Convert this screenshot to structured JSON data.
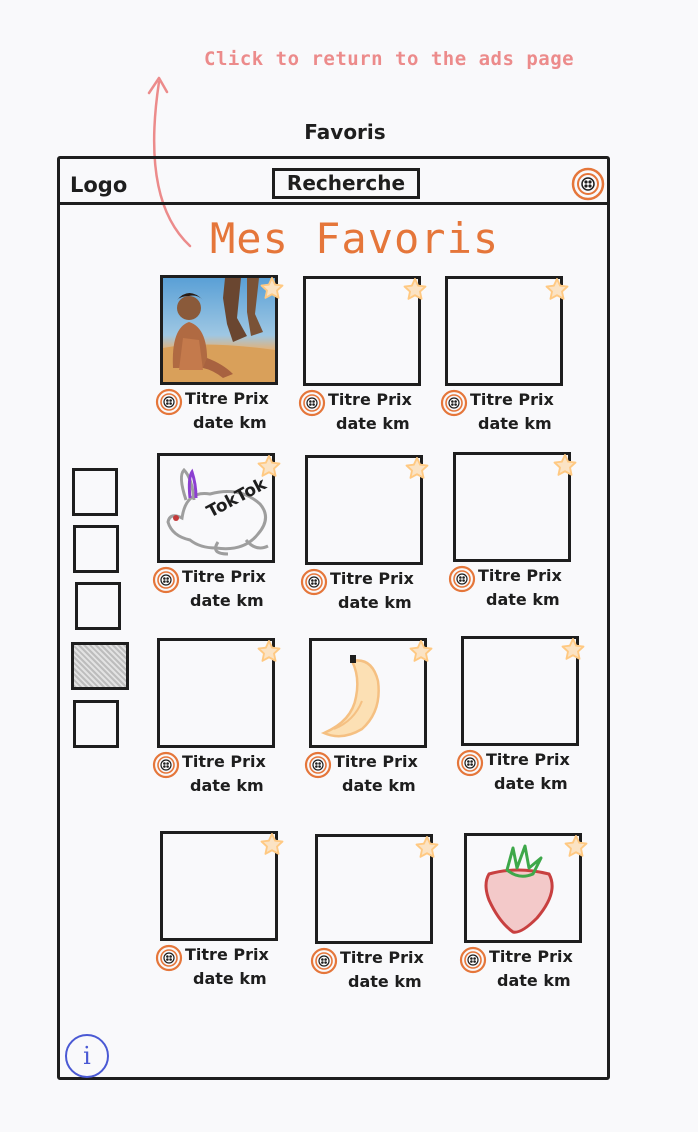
{
  "annotation": {
    "text": "Click to return to the ads page"
  },
  "frame": {
    "title": "Favoris"
  },
  "header": {
    "logo": "Logo",
    "search_label": "Recherche"
  },
  "page": {
    "title": "Mes Favoris"
  },
  "sidebar": {
    "thumb_count": 5,
    "selected_index": 3
  },
  "cards": [
    {
      "title": "Titre Prix",
      "meta": "date km",
      "image": "photo-desert-boy"
    },
    {
      "title": "Titre Prix",
      "meta": "date km",
      "image": "empty"
    },
    {
      "title": "Titre Prix",
      "meta": "date km",
      "image": "empty"
    },
    {
      "title": "Titre Prix",
      "meta": "date km",
      "image": "rabbit-sketch"
    },
    {
      "title": "Titre Prix",
      "meta": "date km",
      "image": "empty"
    },
    {
      "title": "Titre Prix",
      "meta": "date km",
      "image": "empty"
    },
    {
      "title": "Titre Prix",
      "meta": "date km",
      "image": "empty"
    },
    {
      "title": "Titre Prix",
      "meta": "date km",
      "image": "banana-sketch"
    },
    {
      "title": "Titre Prix",
      "meta": "date km",
      "image": "empty"
    },
    {
      "title": "Titre Prix",
      "meta": "date km",
      "image": "empty"
    },
    {
      "title": "Titre Prix",
      "meta": "date km",
      "image": "empty"
    },
    {
      "title": "Titre Prix",
      "meta": "date km",
      "image": "strawberry-sketch"
    }
  ],
  "rabbit_text": "TokTok",
  "info": {
    "glyph": "i"
  },
  "colors": {
    "accent": "#e5763a",
    "annotation": "#ec8b8b",
    "star": "#ffc982",
    "info": "#4a59d4"
  }
}
